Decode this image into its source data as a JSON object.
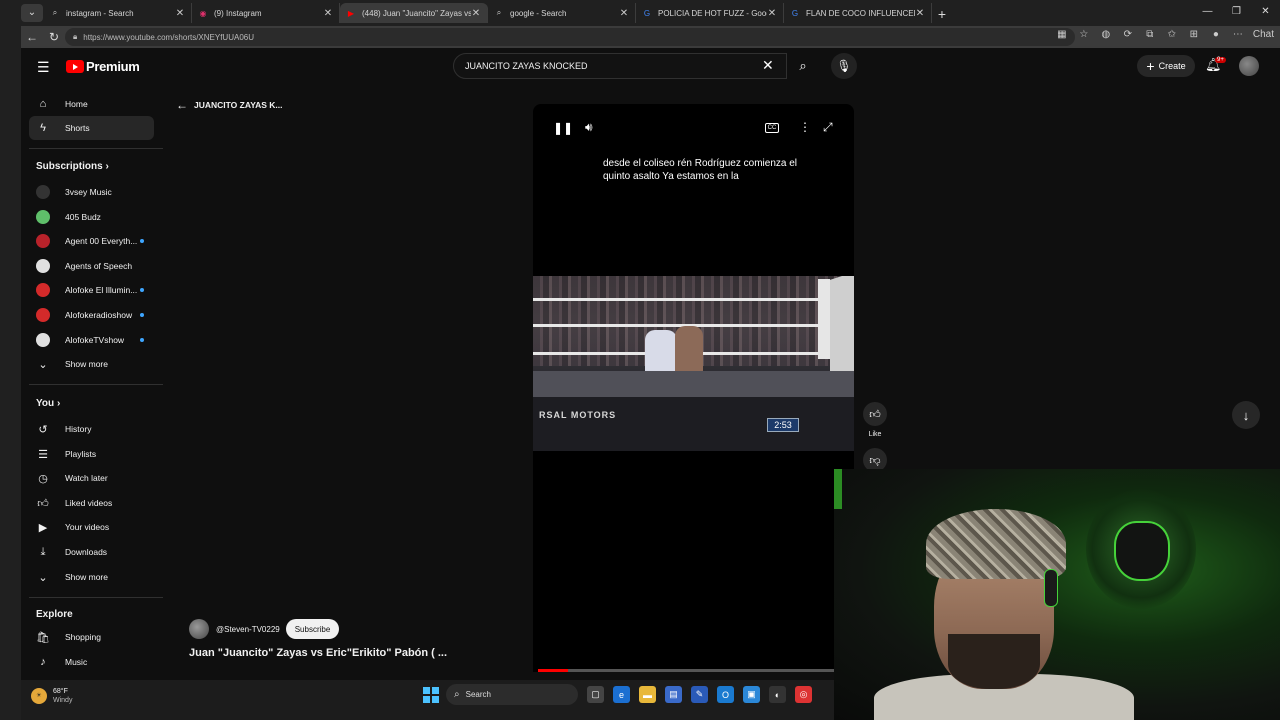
{
  "browser": {
    "tabs": [
      {
        "title": "instagram - Search",
        "icon": "search-icon",
        "active": false
      },
      {
        "title": "(9) Instagram",
        "icon": "instagram-icon",
        "active": false
      },
      {
        "title": "(448) Juan \"Juancito\" Zayas vs",
        "icon": "youtube-icon",
        "active": true
      },
      {
        "title": "google - Search",
        "icon": "search-icon",
        "active": false
      },
      {
        "title": "POLICIA DE HOT FUZZ - Google S",
        "icon": "google-icon",
        "active": false
      },
      {
        "title": "FLAN DE COCO INFLUENCER - Go",
        "icon": "google-icon",
        "active": false
      }
    ],
    "url": "https://www.youtube.com/shorts/XNEYfUUA06U",
    "chat_label": "Chat"
  },
  "youtube": {
    "logo_text": "Premium",
    "search_value": "JUANCITO ZAYAS KNOCKED",
    "create_label": "Create",
    "notifications_badge": "9+",
    "back_label": "JUANCITO ZAYAS K...",
    "sidebar": {
      "main": [
        {
          "label": "Home",
          "icon": "home-icon"
        },
        {
          "label": "Shorts",
          "icon": "shorts-icon",
          "active": true
        }
      ],
      "subscriptions_heading": "Subscriptions",
      "subscriptions": [
        {
          "label": "3vsey Music",
          "color": "#333333",
          "dot": false
        },
        {
          "label": "405 Budz",
          "color": "#5fbf6a",
          "dot": false
        },
        {
          "label": "Agent 00 Everyth...",
          "color": "#b8222a",
          "dot": true
        },
        {
          "label": "Agents of Speech",
          "color": "#e0e0e0",
          "dot": false
        },
        {
          "label": "Alofoke El Illumin...",
          "color": "#d42a2a",
          "dot": true
        },
        {
          "label": "Alofokeradioshow",
          "color": "#d42a2a",
          "dot": true
        },
        {
          "label": "AlofokeTVshow",
          "color": "#e0e0e0",
          "dot": true
        }
      ],
      "subs_show_more": "Show more",
      "you_heading": "You",
      "you_items": [
        {
          "label": "History",
          "icon": "history-icon"
        },
        {
          "label": "Playlists",
          "icon": "playlists-icon"
        },
        {
          "label": "Watch later",
          "icon": "watch-later-icon"
        },
        {
          "label": "Liked videos",
          "icon": "liked-videos-icon"
        },
        {
          "label": "Your videos",
          "icon": "your-videos-icon"
        },
        {
          "label": "Downloads",
          "icon": "downloads-icon"
        }
      ],
      "you_show_more": "Show more",
      "explore_heading": "Explore",
      "explore_items": [
        {
          "label": "Shopping",
          "icon": "shopping-icon"
        },
        {
          "label": "Music",
          "icon": "music-icon"
        }
      ]
    },
    "player": {
      "caption": "desde el coliseo rén Rodríguez comienza el quinto asalto Ya estamos en la",
      "scorebug": "2:53",
      "apron_text": "RSAL  MOTORS",
      "progress": 0.1
    },
    "actions": {
      "like_label": "Like"
    },
    "channel": {
      "handle": "@Steven-TV0229",
      "subscribe_label": "Subscribe"
    },
    "video_title": "Juan \"Juancito\" Zayas vs Eric\"Erikito\" Pabón ( ..."
  },
  "taskbar": {
    "weather_temp": "68°F",
    "weather_desc": "Windy",
    "search_label": "Search"
  }
}
